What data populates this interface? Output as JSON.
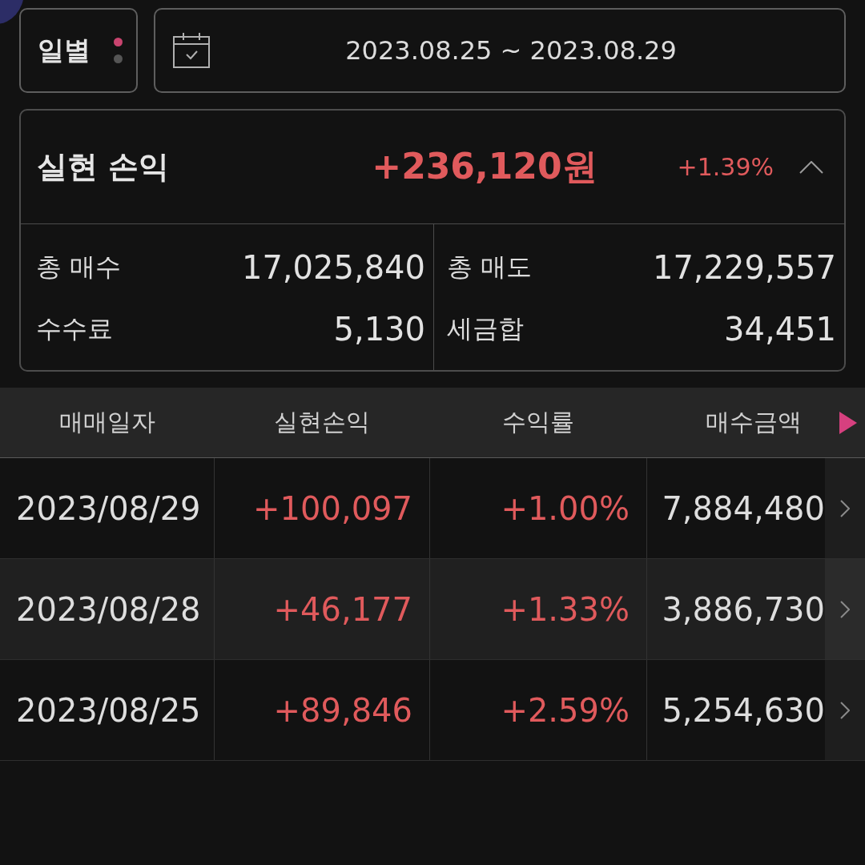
{
  "period_selector": {
    "label": "일별",
    "dots": [
      {
        "selected": true
      },
      {
        "selected": false
      }
    ]
  },
  "date_range": {
    "value": "2023.08.25 ~ 2023.08.29"
  },
  "summary": {
    "title": "실현 손익",
    "amount": "+236,120원",
    "rate": "+1.39%",
    "expanded": true,
    "stats": [
      {
        "label": "총 매수",
        "value": "17,025,840"
      },
      {
        "label": "총 매도",
        "value": "17,229,557"
      },
      {
        "label": "수수료",
        "value": "5,130"
      },
      {
        "label": "세금합",
        "value": "34,451"
      }
    ]
  },
  "table": {
    "columns": [
      "매매일자",
      "실현손익",
      "수익률",
      "매수금액"
    ],
    "rows": [
      {
        "cells": [
          "2023/08/29",
          "+100,097",
          "+1.00%",
          "7,884,480"
        ]
      },
      {
        "cells": [
          "2023/08/28",
          "+46,177",
          "+1.33%",
          "3,886,730"
        ]
      },
      {
        "cells": [
          "2023/08/25",
          "+89,846",
          "+2.59%",
          "5,254,630"
        ]
      }
    ]
  }
}
